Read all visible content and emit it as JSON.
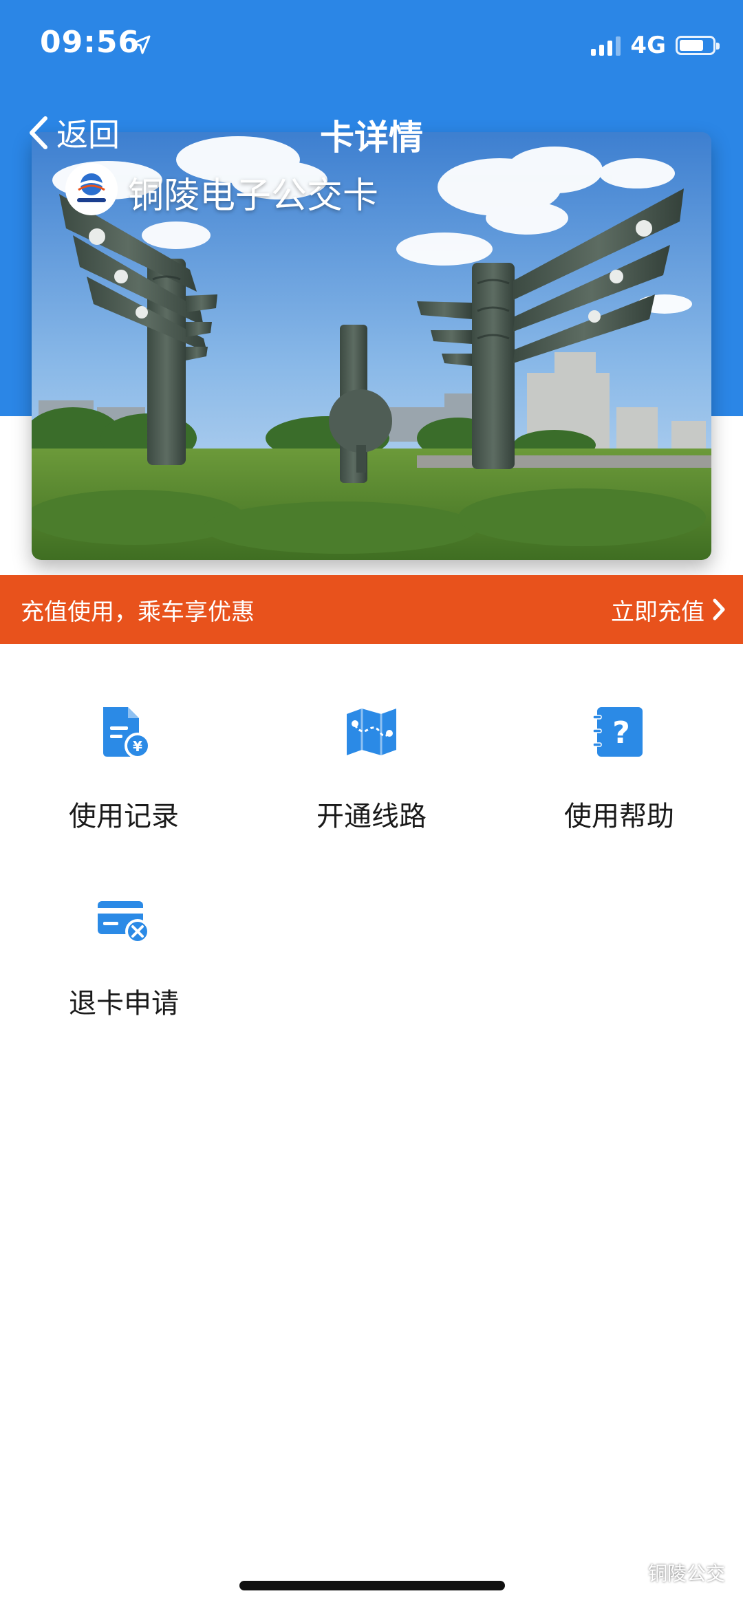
{
  "status_bar": {
    "time": "09:56",
    "network": "4G",
    "location_icon": "location-arrow-icon",
    "signal_icon": "signal-bars-icon",
    "battery_icon": "battery-icon"
  },
  "nav": {
    "back_label": "返回",
    "title": "卡详情",
    "back_icon": "chevron-left-icon"
  },
  "card": {
    "name": "铜陵电子公交卡",
    "logo_icon": "tongling-bus-logo",
    "image": "city-landmark-sculpture-photo"
  },
  "promo": {
    "text": "充值使用，乘车享优惠",
    "action_label": "立即充值",
    "action_icon": "chevron-right-icon"
  },
  "menu": [
    {
      "label": "使用记录",
      "icon": "receipt-yuan-icon"
    },
    {
      "label": "开通线路",
      "icon": "route-map-icon"
    },
    {
      "label": "使用帮助",
      "icon": "help-question-icon"
    },
    {
      "label": "退卡申请",
      "icon": "card-cancel-icon"
    }
  ],
  "watermark": {
    "text": "铜陵公交",
    "icon": "wechat-icon"
  },
  "colors": {
    "header_blue": "#2b86e6",
    "icon_blue": "#2b8ae6",
    "promo_orange": "#e8521c",
    "text_dark": "#1a1a1a"
  }
}
